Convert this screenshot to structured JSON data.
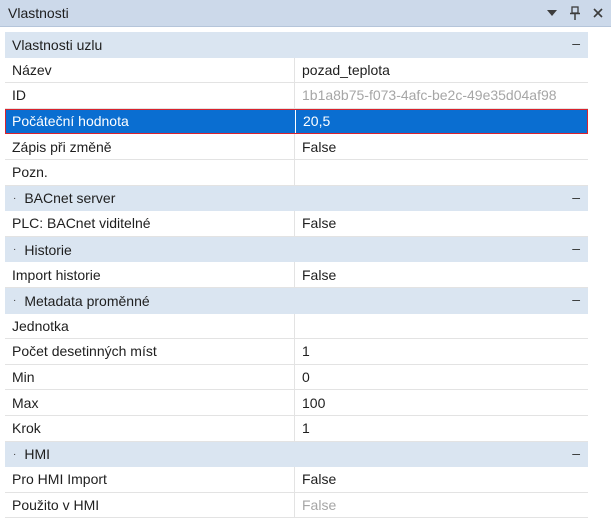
{
  "panel": {
    "title": "Vlastnosti"
  },
  "titlebar_icons": [
    {
      "icon": "chevron-down-icon"
    },
    {
      "icon": "pin-icon"
    },
    {
      "icon": "close-icon"
    }
  ],
  "rows": [
    {
      "kind": "category",
      "label": "Vlastnosti uzlu",
      "dot": false
    },
    {
      "kind": "prop",
      "name": "Název",
      "value": "pozad_teplota"
    },
    {
      "kind": "prop",
      "name": "ID",
      "value": "1b1a8b75-f073-4afc-be2c-49e35d04af98",
      "dim": true
    },
    {
      "kind": "prop",
      "name": "Počáteční hodnota",
      "value": "20,5",
      "selected": true
    },
    {
      "kind": "prop",
      "name": "Zápis při změně",
      "value": "False"
    },
    {
      "kind": "prop",
      "name": "Pozn.",
      "value": ""
    },
    {
      "kind": "category",
      "label": "BACnet server",
      "dot": true
    },
    {
      "kind": "prop",
      "name": "PLC: BACnet viditelné",
      "value": "False"
    },
    {
      "kind": "category",
      "label": "Historie",
      "dot": true
    },
    {
      "kind": "prop",
      "name": "Import historie",
      "value": "False"
    },
    {
      "kind": "category",
      "label": "Metadata proměnné",
      "dot": true
    },
    {
      "kind": "prop",
      "name": "Jednotka",
      "value": ""
    },
    {
      "kind": "prop",
      "name": "Počet desetinných míst",
      "value": "1"
    },
    {
      "kind": "prop",
      "name": "Min",
      "value": "0"
    },
    {
      "kind": "prop",
      "name": "Max",
      "value": "100"
    },
    {
      "kind": "prop",
      "name": "Krok",
      "value": "1"
    },
    {
      "kind": "category",
      "label": "HMI",
      "dot": true
    },
    {
      "kind": "prop",
      "name": "Pro HMI Import",
      "value": "False"
    },
    {
      "kind": "prop",
      "name": "Použito v HMI",
      "value": "False",
      "dim": true
    }
  ],
  "glyphs": {
    "collapse": "–",
    "dot": "·"
  }
}
